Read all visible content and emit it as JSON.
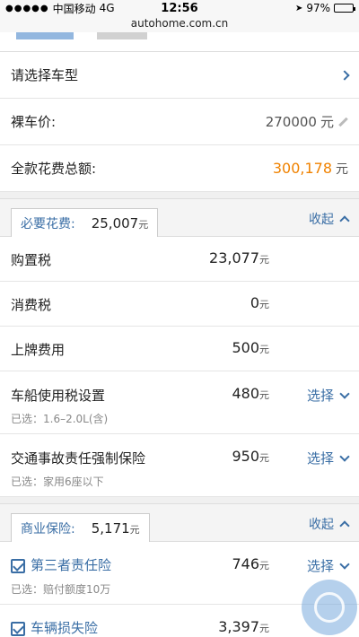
{
  "status_bar": {
    "carrier": "中国移动",
    "network": "4G",
    "time": "12:56",
    "battery": "97%",
    "battery_level": 0.97
  },
  "address_bar": {
    "url": "autohome.com.cn"
  },
  "form": {
    "select_model": "请选择车型",
    "bare_price_label": "裸车价:",
    "bare_price_value": "270000",
    "bare_price_unit": "元",
    "total_label": "全款花费总额:",
    "total_value": "300,178",
    "total_unit": "元"
  },
  "required": {
    "tab_label": "必要花费:",
    "tab_value": "25,007",
    "tab_unit": "元",
    "collapse_label": "收起",
    "items": [
      {
        "label": "购置税",
        "amount": "23,077",
        "unit": "元"
      },
      {
        "label": "消费税",
        "amount": "0",
        "unit": "元"
      },
      {
        "label": "上牌费用",
        "amount": "500",
        "unit": "元"
      },
      {
        "label": "车船使用税设置",
        "amount": "480",
        "unit": "元",
        "action": "选择",
        "sub": "已选：1.6–2.0L(含)"
      },
      {
        "label": "交通事故责任强制保险",
        "amount": "950",
        "unit": "元",
        "action": "选择",
        "sub": "已选：家用6座以下"
      }
    ]
  },
  "commercial": {
    "tab_label": "商业保险:",
    "tab_value": "5,171",
    "tab_unit": "元",
    "collapse_label": "收起",
    "items": [
      {
        "label": "第三者责任险",
        "amount": "746",
        "unit": "元",
        "action": "选择",
        "sub": "已选：赔付额度10万"
      },
      {
        "label": "车辆损失险",
        "amount": "3,397",
        "unit": "元"
      }
    ]
  },
  "colors": {
    "accent": "#3a6ea5",
    "total": "#f08200"
  },
  "icons": [
    "location-icon",
    "battery-icon",
    "chevron-right-icon",
    "pencil-icon",
    "chevron-up-icon",
    "chevron-down-icon",
    "checkbox-icon",
    "watermark-logo"
  ]
}
